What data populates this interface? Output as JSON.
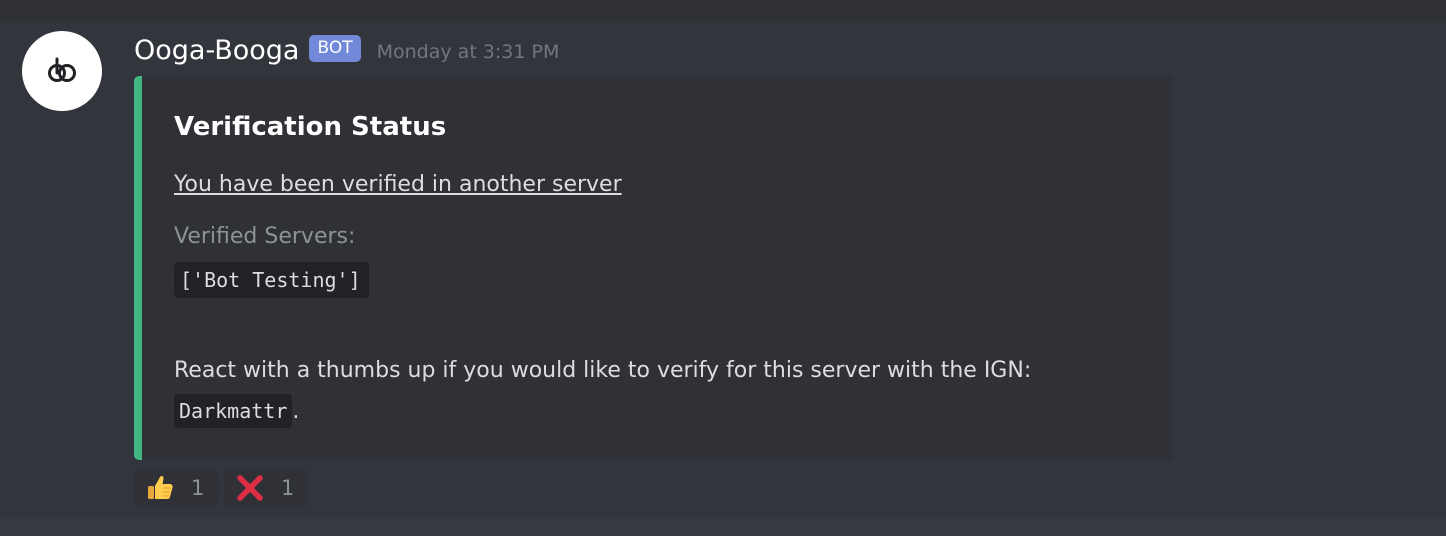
{
  "message": {
    "author": "Ooga-Booga",
    "bot_tag": "BOT",
    "timestamp": "Monday at 3:31 PM"
  },
  "embed": {
    "accent_color": "#43b581",
    "title": "Verification Status",
    "link_text": "You have been verified in another server",
    "field_name": "Verified Servers:",
    "field_value": "['Bot Testing']",
    "react_text": "React with a thumbs up if you would like to verify for this server with the IGN:",
    "ign": "Darkmattr",
    "ign_suffix": "."
  },
  "reactions": [
    {
      "emoji": "thumbs-up-icon",
      "count": "1"
    },
    {
      "emoji": "cross-mark-icon",
      "count": "1"
    }
  ],
  "colors": {
    "background": "#36393f",
    "embed_background": "#2f3136",
    "bot_tag": "#7289da"
  }
}
